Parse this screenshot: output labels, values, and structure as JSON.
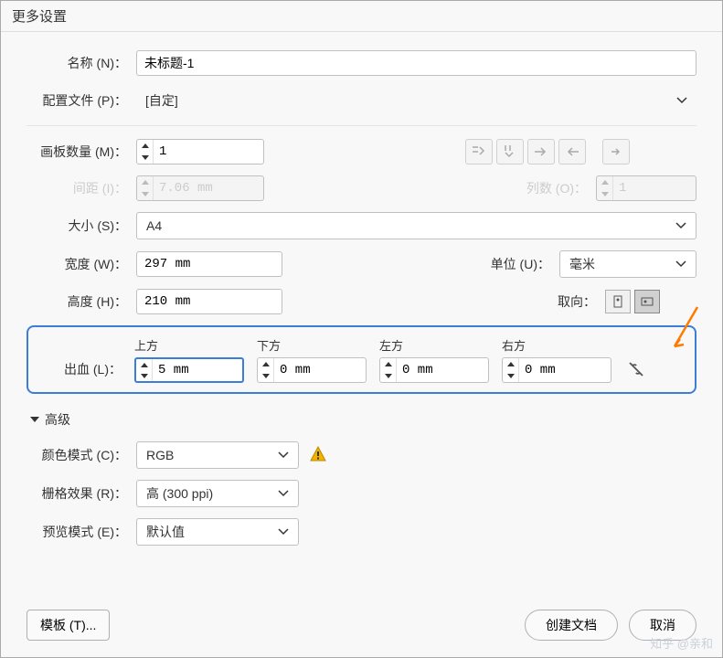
{
  "title": "更多设置",
  "name": {
    "label": "名称 (N)：",
    "value": "未标题-1"
  },
  "profile": {
    "label": "配置文件 (P)：",
    "value": "[自定]"
  },
  "artboards": {
    "label": "画板数量 (M)：",
    "value": "1"
  },
  "spacing": {
    "label": "间距 (I)：",
    "value": "7.06 mm"
  },
  "columns": {
    "label": "列数 (O)：",
    "value": "1"
  },
  "size": {
    "label": "大小 (S)：",
    "value": "A4"
  },
  "width": {
    "label": "宽度 (W)：",
    "value": "297 mm"
  },
  "units": {
    "label": "单位 (U)：",
    "value": "毫米"
  },
  "height": {
    "label": "高度 (H)：",
    "value": "210 mm"
  },
  "orientation": {
    "label": "取向："
  },
  "bleed": {
    "label": "出血 (L)：",
    "top": {
      "label": "上方",
      "value": "5 mm"
    },
    "bottom": {
      "label": "下方",
      "value": "0 mm"
    },
    "left": {
      "label": "左方",
      "value": "0 mm"
    },
    "right": {
      "label": "右方",
      "value": "0 mm"
    }
  },
  "advanced": "高级",
  "colorMode": {
    "label": "颜色模式 (C)：",
    "value": "RGB"
  },
  "raster": {
    "label": "栅格效果 (R)：",
    "value": "高 (300 ppi)"
  },
  "preview": {
    "label": "预览模式 (E)：",
    "value": "默认值"
  },
  "buttons": {
    "template": "模板 (T)...",
    "create": "创建文档",
    "cancel": "取消"
  },
  "watermark": "知乎 @亲和"
}
